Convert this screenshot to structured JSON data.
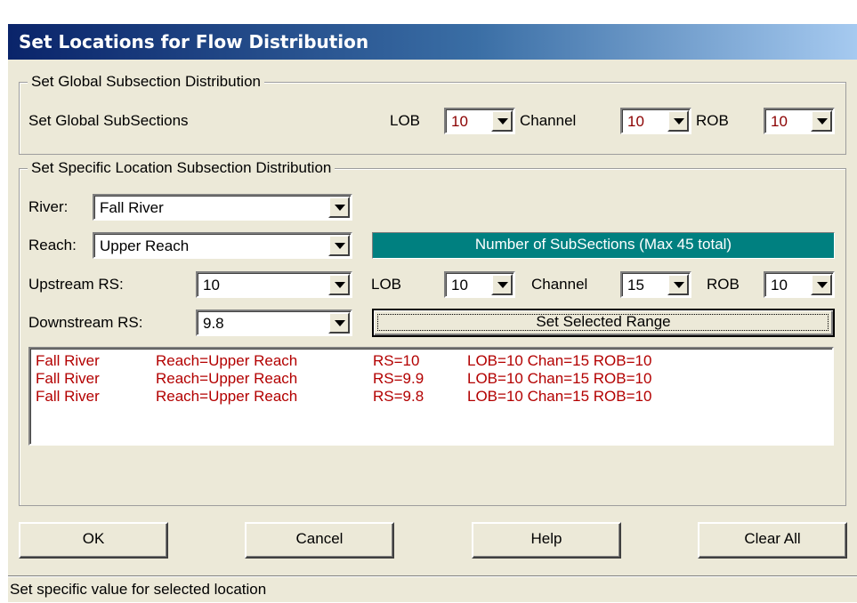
{
  "window": {
    "title": "Set Locations for Flow Distribution"
  },
  "global": {
    "group_label": "Set Global Subsection Distribution",
    "row_label": "Set Global SubSections",
    "lob_label": "LOB",
    "lob_value": "10",
    "channel_label": "Channel",
    "channel_value": "10",
    "rob_label": "ROB",
    "rob_value": "10"
  },
  "specific": {
    "group_label": "Set Specific Location Subsection Distribution",
    "river_label": "River:",
    "river_value": "Fall River",
    "reach_label": "Reach:",
    "reach_value": "Upper Reach",
    "subsections_header": "Number of SubSections (Max 45 total)",
    "upstream_label": "Upstream RS:",
    "upstream_value": "10",
    "downstream_label": "Downstream RS:",
    "downstream_value": "9.8",
    "lob_label": "LOB",
    "lob_value": "10",
    "channel_label": "Channel",
    "channel_value": "15",
    "rob_label": "ROB",
    "rob_value": "10",
    "set_range_label": "Set Selected Range"
  },
  "locations": [
    {
      "river": "Fall River",
      "reach": "Reach=Upper Reach",
      "rs": "RS=10",
      "dist": "LOB=10 Chan=15 ROB=10"
    },
    {
      "river": "Fall River",
      "reach": "Reach=Upper Reach",
      "rs": "RS=9.9",
      "dist": "LOB=10 Chan=15 ROB=10"
    },
    {
      "river": "Fall River",
      "reach": "Reach=Upper Reach",
      "rs": "RS=9.8",
      "dist": "LOB=10 Chan=15 ROB=10"
    }
  ],
  "buttons": {
    "ok": "OK",
    "cancel": "Cancel",
    "help": "Help",
    "clear_all": "Clear All"
  },
  "status": {
    "text": "Set specific value for selected location"
  },
  "colors": {
    "accent_teal": "#008080",
    "list_text": "#b30000",
    "value_text": "#8b0000"
  }
}
